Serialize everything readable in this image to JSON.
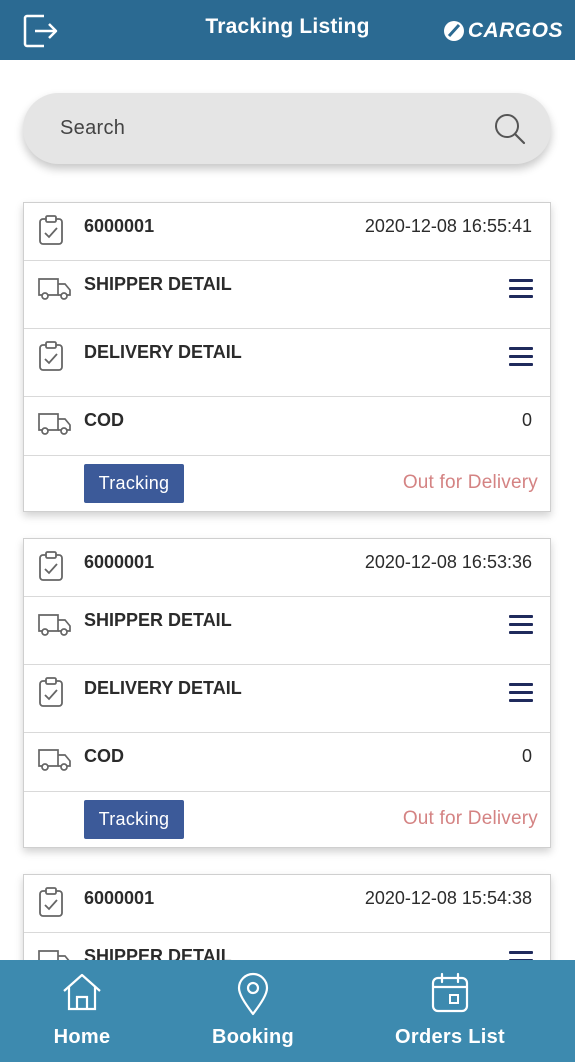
{
  "header": {
    "title": "Tracking Listing",
    "brand": "CARGOS",
    "logout_icon": "logout-icon"
  },
  "search": {
    "placeholder": "Search",
    "icon": "search-icon"
  },
  "orders": [
    {
      "order_no": "6000001",
      "datetime": "2020-12-08 16:55:41",
      "shipper_label": "SHIPPER DETAIL",
      "delivery_label": "DELIVERY DETAIL",
      "cod_label": "COD",
      "cod_value": "0",
      "tracking_label": "Tracking",
      "status": "Out for Delivery"
    },
    {
      "order_no": "6000001",
      "datetime": "2020-12-08 16:53:36",
      "shipper_label": "SHIPPER DETAIL",
      "delivery_label": "DELIVERY DETAIL",
      "cod_label": "COD",
      "cod_value": "0",
      "tracking_label": "Tracking",
      "status": "Out for Delivery"
    },
    {
      "order_no": "6000001",
      "datetime": "2020-12-08 15:54:38",
      "shipper_label": "SHIPPER DETAIL"
    }
  ],
  "bottom_nav": {
    "home": "Home",
    "booking": "Booking",
    "orders": "Orders List"
  },
  "colors": {
    "header_bg": "#2b6a92",
    "nav_bg": "#3d8aaf",
    "button_bg": "#3c5a99",
    "status_text": "#d48383",
    "menu_icon": "#1f2a5c"
  }
}
